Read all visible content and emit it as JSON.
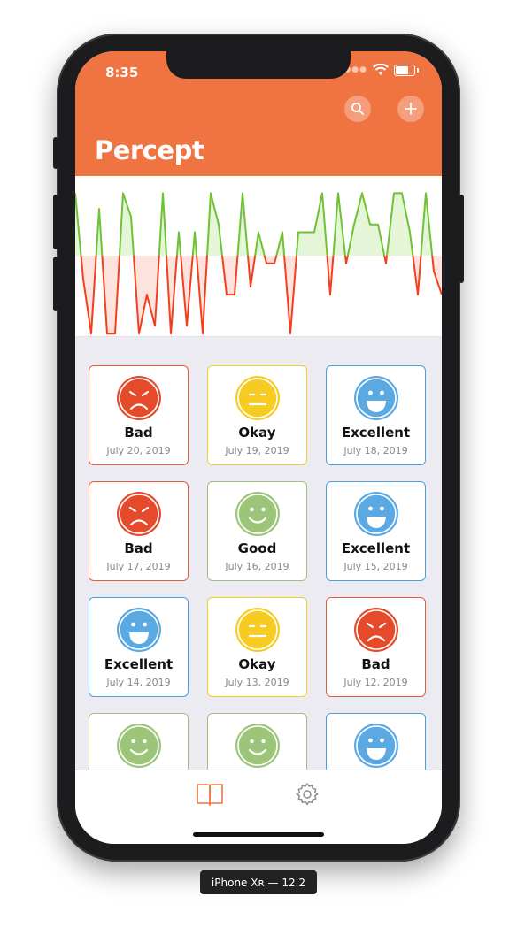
{
  "status_bar": {
    "time": "8:35"
  },
  "header": {
    "title": "Percept"
  },
  "chart_data": {
    "type": "line",
    "title": "",
    "values": [
      0.8,
      -0.3,
      -1,
      0.6,
      -1,
      -1,
      0.8,
      0.5,
      -1,
      -0.5,
      -0.9,
      0.8,
      -1,
      0.3,
      -0.9,
      0.3,
      -1,
      0.8,
      0.4,
      -0.5,
      -0.5,
      0.8,
      -0.4,
      0.3,
      -0.1,
      -0.1,
      0.3,
      -1,
      0.3,
      0.3,
      0.3,
      0.8,
      -0.5,
      0.8,
      -0.1,
      0.4,
      0.8,
      0.4,
      0.4,
      -0.1,
      0.8,
      0.8,
      0.3,
      -0.5,
      0.8,
      -0.2,
      -0.5
    ],
    "ylim": [
      -1,
      1
    ],
    "colors": {
      "positive": "#6fc233",
      "negative": "#f2401e",
      "positive_fill": "#e5f5d8",
      "negative_fill": "#fde3dd"
    }
  },
  "entries": [
    {
      "mood": "Bad",
      "date": "July 20, 2019",
      "type": "bad"
    },
    {
      "mood": "Okay",
      "date": "July 19, 2019",
      "type": "okay"
    },
    {
      "mood": "Excellent",
      "date": "July 18, 2019",
      "type": "excellent"
    },
    {
      "mood": "Bad",
      "date": "July 17, 2019",
      "type": "bad"
    },
    {
      "mood": "Good",
      "date": "July 16, 2019",
      "type": "good"
    },
    {
      "mood": "Excellent",
      "date": "July 15, 2019",
      "type": "excellent"
    },
    {
      "mood": "Excellent",
      "date": "July 14, 2019",
      "type": "excellent"
    },
    {
      "mood": "Okay",
      "date": "July 13, 2019",
      "type": "okay"
    },
    {
      "mood": "Bad",
      "date": "July 12, 2019",
      "type": "bad"
    },
    {
      "mood": "",
      "date": "",
      "type": "good"
    },
    {
      "mood": "",
      "date": "",
      "type": "good"
    },
    {
      "mood": "",
      "date": "",
      "type": "excellent"
    }
  ],
  "mood_colors": {
    "bad": {
      "border": "#e9593d",
      "fill": "#e54a2a",
      "ring": "#ffffff"
    },
    "okay": {
      "border": "#f3cd2a",
      "fill": "#f7cc22",
      "ring": "#ffffff"
    },
    "good": {
      "border": "#9fc27e",
      "fill": "#9cc57a",
      "ring": "#ffffff"
    },
    "excellent": {
      "border": "#4b9fda",
      "fill": "#5aa9e2",
      "ring": "#ffffff"
    }
  },
  "tab_bar": {
    "active_color": "#f07442",
    "inactive_color": "#8e8e93",
    "tabs": [
      "journal-icon",
      "gear-icon"
    ]
  },
  "device_label": "iPhone Xʀ — 12.2"
}
